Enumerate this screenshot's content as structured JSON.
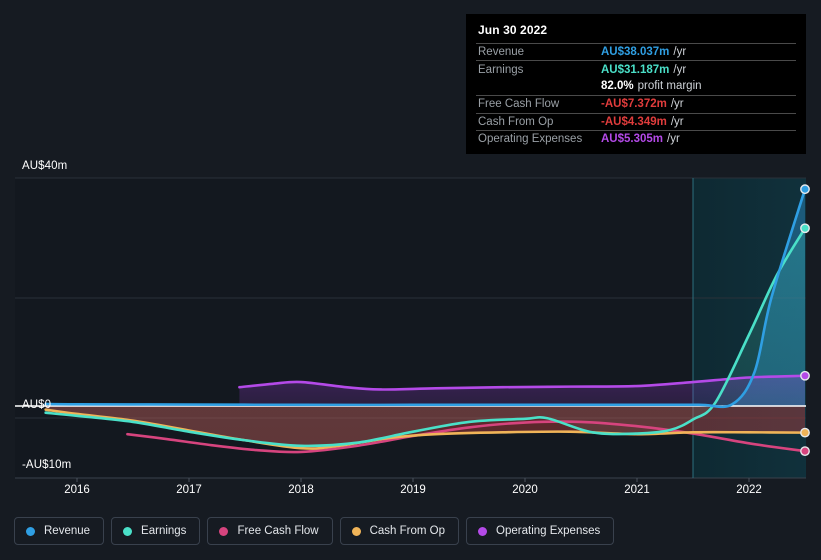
{
  "tooltip": {
    "date": "Jun 30 2022",
    "rows": [
      {
        "label": "Revenue",
        "value": "AU$38.037m",
        "unit": "/yr",
        "color": "#2f9fe3"
      },
      {
        "label": "Earnings",
        "value": "AU$31.187m",
        "unit": "/yr",
        "color": "#4ae0c8"
      },
      {
        "label": "",
        "value": "82.0%",
        "unit": "profit margin",
        "color": "#ffffff"
      },
      {
        "label": "Free Cash Flow",
        "value": "-AU$7.372m",
        "unit": "/yr",
        "color": "#e03c3c"
      },
      {
        "label": "Cash From Op",
        "value": "-AU$4.349m",
        "unit": "/yr",
        "color": "#e03c3c"
      },
      {
        "label": "Operating Expenses",
        "value": "AU$5.305m",
        "unit": "/yr",
        "color": "#b44ae8"
      }
    ]
  },
  "legend": {
    "items": [
      {
        "label": "Revenue",
        "color": "#2f9fe3"
      },
      {
        "label": "Earnings",
        "color": "#4ae0c8"
      },
      {
        "label": "Free Cash Flow",
        "color": "#d6447e"
      },
      {
        "label": "Cash From Op",
        "color": "#f0b458"
      },
      {
        "label": "Operating Expenses",
        "color": "#b44ae8"
      }
    ]
  },
  "axis": {
    "y_top_label": "AU$40m",
    "y_zero_label": "AU$0",
    "y_neg_label": "-AU$10m",
    "x_labels": [
      "2016",
      "2017",
      "2018",
      "2019",
      "2020",
      "2021",
      "2022"
    ]
  },
  "chart_data": {
    "type": "line",
    "title": "",
    "xlabel": "",
    "ylabel": "AU$",
    "ylim": [
      -12,
      42
    ],
    "yticks": [
      40,
      0,
      -10
    ],
    "ytick_labels": [
      "AU$40m",
      "AU$0",
      "-AU$10m"
    ],
    "xlim": [
      2015.7,
      2022.5
    ],
    "x": [
      "2016",
      "2017",
      "2018",
      "2019",
      "2020",
      "2021",
      "2022"
    ],
    "grid": true,
    "legend_position": "bottom",
    "forecast_start": "2021.5",
    "units": "AU$m",
    "series": [
      {
        "name": "Revenue",
        "color": "#2f9fe3",
        "points": [
          {
            "x": 2015.72,
            "y": 0.35
          },
          {
            "x": 2016.0,
            "y": 0.3
          },
          {
            "x": 2017.0,
            "y": 0.25
          },
          {
            "x": 2018.0,
            "y": 0.2
          },
          {
            "x": 2019.0,
            "y": 0.2
          },
          {
            "x": 2020.0,
            "y": 0.2
          },
          {
            "x": 2021.0,
            "y": 0.2
          },
          {
            "x": 2021.55,
            "y": 0.2
          },
          {
            "x": 2021.85,
            "y": 0.3
          },
          {
            "x": 2022.05,
            "y": 6.0
          },
          {
            "x": 2022.2,
            "y": 19.0
          },
          {
            "x": 2022.5,
            "y": 38.037
          }
        ]
      },
      {
        "name": "Earnings",
        "color": "#4ae0c8",
        "points": [
          {
            "x": 2015.72,
            "y": -1.1
          },
          {
            "x": 2016.0,
            "y": -1.6
          },
          {
            "x": 2016.5,
            "y": -2.6
          },
          {
            "x": 2017.0,
            "y": -4.2
          },
          {
            "x": 2017.5,
            "y": -5.6
          },
          {
            "x": 2018.0,
            "y": -6.5
          },
          {
            "x": 2018.5,
            "y": -6.0
          },
          {
            "x": 2019.0,
            "y": -4.2
          },
          {
            "x": 2019.5,
            "y": -2.6
          },
          {
            "x": 2020.0,
            "y": -2.1
          },
          {
            "x": 2020.2,
            "y": -2.0
          },
          {
            "x": 2020.6,
            "y": -4.3
          },
          {
            "x": 2021.0,
            "y": -4.5
          },
          {
            "x": 2021.3,
            "y": -3.9
          },
          {
            "x": 2021.5,
            "y": -2.2
          },
          {
            "x": 2021.7,
            "y": 0.6
          },
          {
            "x": 2022.0,
            "y": 12.5
          },
          {
            "x": 2022.25,
            "y": 23.0
          },
          {
            "x": 2022.5,
            "y": 31.187
          }
        ]
      },
      {
        "name": "Free Cash Flow",
        "color": "#d6447e",
        "points": [
          {
            "x": 2016.45,
            "y": -4.6
          },
          {
            "x": 2016.8,
            "y": -5.4
          },
          {
            "x": 2017.2,
            "y": -6.4
          },
          {
            "x": 2017.6,
            "y": -7.2
          },
          {
            "x": 2018.0,
            "y": -7.5
          },
          {
            "x": 2018.5,
            "y": -6.5
          },
          {
            "x": 2019.0,
            "y": -4.9
          },
          {
            "x": 2019.5,
            "y": -3.5
          },
          {
            "x": 2020.0,
            "y": -2.7
          },
          {
            "x": 2020.5,
            "y": -2.6
          },
          {
            "x": 2021.0,
            "y": -3.3
          },
          {
            "x": 2021.5,
            "y": -4.5
          },
          {
            "x": 2022.0,
            "y": -6.1
          },
          {
            "x": 2022.5,
            "y": -7.372
          }
        ]
      },
      {
        "name": "Cash From Op",
        "color": "#f0b458",
        "points": [
          {
            "x": 2015.72,
            "y": -0.6
          },
          {
            "x": 2016.0,
            "y": -1.3
          },
          {
            "x": 2016.5,
            "y": -2.4
          },
          {
            "x": 2017.0,
            "y": -4.0
          },
          {
            "x": 2017.5,
            "y": -5.6
          },
          {
            "x": 2018.0,
            "y": -6.9
          },
          {
            "x": 2018.3,
            "y": -6.6
          },
          {
            "x": 2018.8,
            "y": -5.2
          },
          {
            "x": 2019.2,
            "y": -4.6
          },
          {
            "x": 2019.8,
            "y": -4.3
          },
          {
            "x": 2020.4,
            "y": -4.2
          },
          {
            "x": 2021.0,
            "y": -4.6
          },
          {
            "x": 2021.5,
            "y": -4.3
          },
          {
            "x": 2022.0,
            "y": -4.3
          },
          {
            "x": 2022.5,
            "y": -4.349
          }
        ]
      },
      {
        "name": "Operating Expenses",
        "color": "#b44ae8",
        "points": [
          {
            "x": 2017.45,
            "y": 3.3
          },
          {
            "x": 2017.75,
            "y": 3.9
          },
          {
            "x": 2018.0,
            "y": 4.2
          },
          {
            "x": 2018.4,
            "y": 3.3
          },
          {
            "x": 2018.7,
            "y": 2.9
          },
          {
            "x": 2019.2,
            "y": 3.1
          },
          {
            "x": 2019.8,
            "y": 3.3
          },
          {
            "x": 2020.4,
            "y": 3.4
          },
          {
            "x": 2021.0,
            "y": 3.5
          },
          {
            "x": 2021.5,
            "y": 4.2
          },
          {
            "x": 2022.0,
            "y": 5.0
          },
          {
            "x": 2022.5,
            "y": 5.305
          }
        ]
      }
    ]
  },
  "colors": {
    "background": "#161b22",
    "plot_background": "#13181f",
    "forecast_tint": "#0d2b33",
    "gridline": "#2a3139",
    "zero_line": "#ffffff",
    "tooltip_bg": "#000000",
    "negative": "#e03c3c"
  }
}
